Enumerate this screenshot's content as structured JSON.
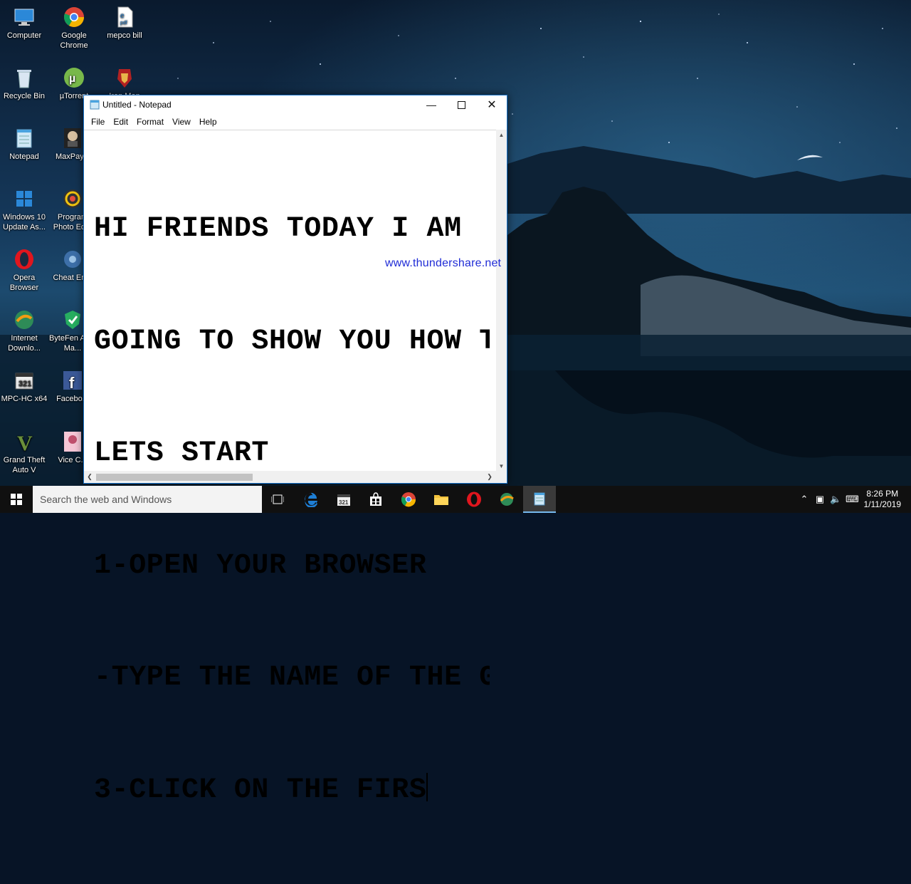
{
  "desktop": {
    "icons": [
      {
        "label": "Computer"
      },
      {
        "label": "Google Chrome"
      },
      {
        "label": "mepco bill"
      },
      {
        "label": "Recycle Bin"
      },
      {
        "label": "µTorrent"
      },
      {
        "label": "Iron Man"
      },
      {
        "label": "Notepad"
      },
      {
        "label": "MaxPay..."
      },
      {
        "label": "Windows 10 Update As..."
      },
      {
        "label": "Program Photo Ed..."
      },
      {
        "label": "Opera Browser"
      },
      {
        "label": "Cheat En..."
      },
      {
        "label": "Internet Downlo..."
      },
      {
        "label": "ByteFen Anti-Ma..."
      },
      {
        "label": "MPC-HC x64"
      },
      {
        "label": "Facebo..."
      },
      {
        "label": "Grand Theft Auto V"
      },
      {
        "label": "Vice C..."
      }
    ],
    "watermark": "www.thundershare.net"
  },
  "notepad": {
    "title": "Untitled - Notepad",
    "menu": [
      "File",
      "Edit",
      "Format",
      "View",
      "Help"
    ],
    "lines": [
      "HI FRIENDS TODAY I AM",
      "GOING TO SHOW YOU HOW T",
      "LETS START",
      "1-OPEN YOUR BROWSER",
      "-TYPE THE NAME OF THE G",
      "3-CLICK ON THE FIRS"
    ]
  },
  "taskbar": {
    "search_placeholder": "Search the web and Windows",
    "time": "8:26 PM",
    "date": "1/11/2019"
  },
  "colors": {
    "accent": "#1a73c9",
    "taskbar": "#101010",
    "watermark": "#1f2bd6"
  }
}
